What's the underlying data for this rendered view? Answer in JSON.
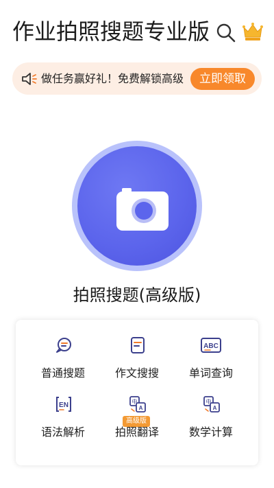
{
  "header": {
    "title": "作业拍照搜题专业版",
    "search_icon": "search-icon",
    "vip_icon": "crown-icon"
  },
  "banner": {
    "text": "做任务赢好礼！免费解锁高级",
    "button_label": "立即领取",
    "icon": "speaker-icon"
  },
  "camera": {
    "label": "拍照搜题(高级版)",
    "icon": "camera-icon"
  },
  "tools": [
    {
      "label": "普通搜题",
      "icon": "chat-search-icon"
    },
    {
      "label": "作文搜搜",
      "icon": "document-icon"
    },
    {
      "label": "单词查询",
      "icon": "abc-icon"
    },
    {
      "label": "语法解析",
      "icon": "en-icon"
    },
    {
      "label": "拍照翻译",
      "icon": "translate-icon",
      "badge": "高级版"
    },
    {
      "label": "数学计算",
      "icon": "translate-icon"
    }
  ],
  "colors": {
    "accent": "#5c65ec",
    "banner_bg": "#fdeee4",
    "orange": "#f8882b"
  }
}
